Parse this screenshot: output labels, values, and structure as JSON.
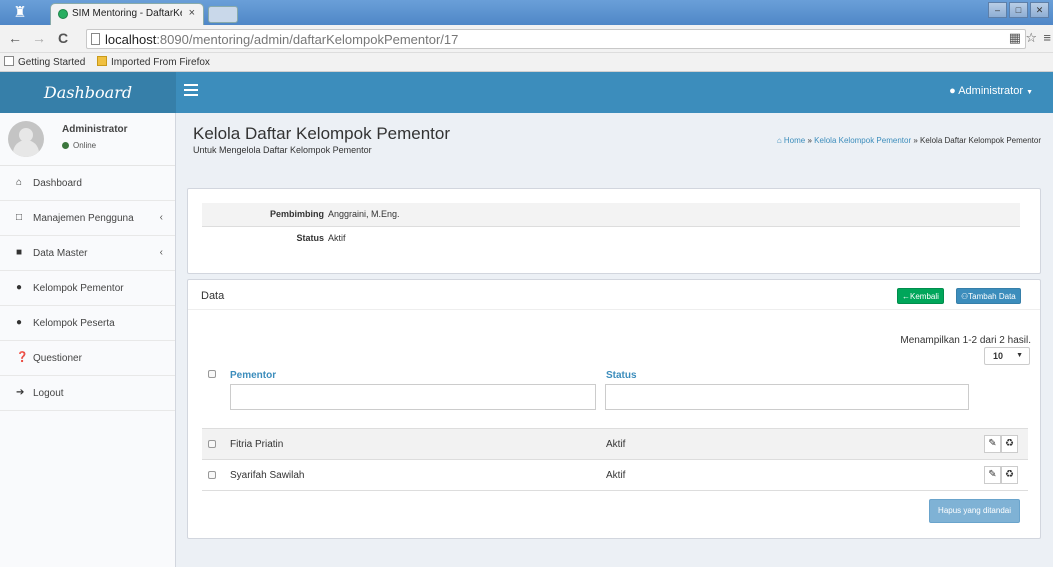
{
  "browser": {
    "tab_title": "SIM Mentoring - DaftarKelom",
    "tab_close": "×",
    "url_host": "localhost",
    "url_rest": ":8090/mentoring/admin/daftarKelompokPementor/17",
    "bookmarks": [
      "Getting Started",
      "Imported From Firefox"
    ]
  },
  "header": {
    "logo": "Dashboard",
    "user_menu": "Administrator"
  },
  "sidebar": {
    "user_name": "Administrator",
    "user_status": "Online",
    "items": [
      {
        "label": "Dashboard",
        "icon": "home-icon"
      },
      {
        "label": "Manajemen Pengguna",
        "icon": "unlock-icon"
      },
      {
        "label": "Data Master",
        "icon": "book-icon"
      },
      {
        "label": "Kelompok Pementor",
        "icon": "users-icon"
      },
      {
        "label": "Kelompok Peserta",
        "icon": "users-icon"
      },
      {
        "label": "Questioner",
        "icon": "question-icon"
      },
      {
        "label": "Logout",
        "icon": "signout-icon"
      }
    ]
  },
  "page": {
    "title": "Kelola Daftar Kelompok Pementor",
    "subtitle": "Untuk Mengelola Daftar Kelompok Pementor",
    "breadcrumb": {
      "home": "Home",
      "sep1": "»",
      "parent": "Kelola Kelompok Pementor",
      "sep2": "»",
      "current": "Kelola Daftar Kelompok Pementor"
    }
  },
  "detail": {
    "pembimbing_label": "Pembimbing",
    "pembimbing_value": "Anggraini, M.Eng.",
    "status_label": "Status",
    "status_value": "Aktif"
  },
  "data_box": {
    "title": "Data",
    "back_button": "Kembali",
    "add_button": "Tambah Data",
    "summary": "Menampilkan 1-2 dari 2 hasil.",
    "page_size": "10",
    "columns": [
      "Pementor",
      "Status"
    ],
    "rows": [
      {
        "pementor": "Fitria Priatin",
        "status": "Aktif"
      },
      {
        "pementor": "Syarifah Sawilah",
        "status": "Aktif"
      }
    ],
    "delete_selected": "Hapus yang ditandai"
  }
}
